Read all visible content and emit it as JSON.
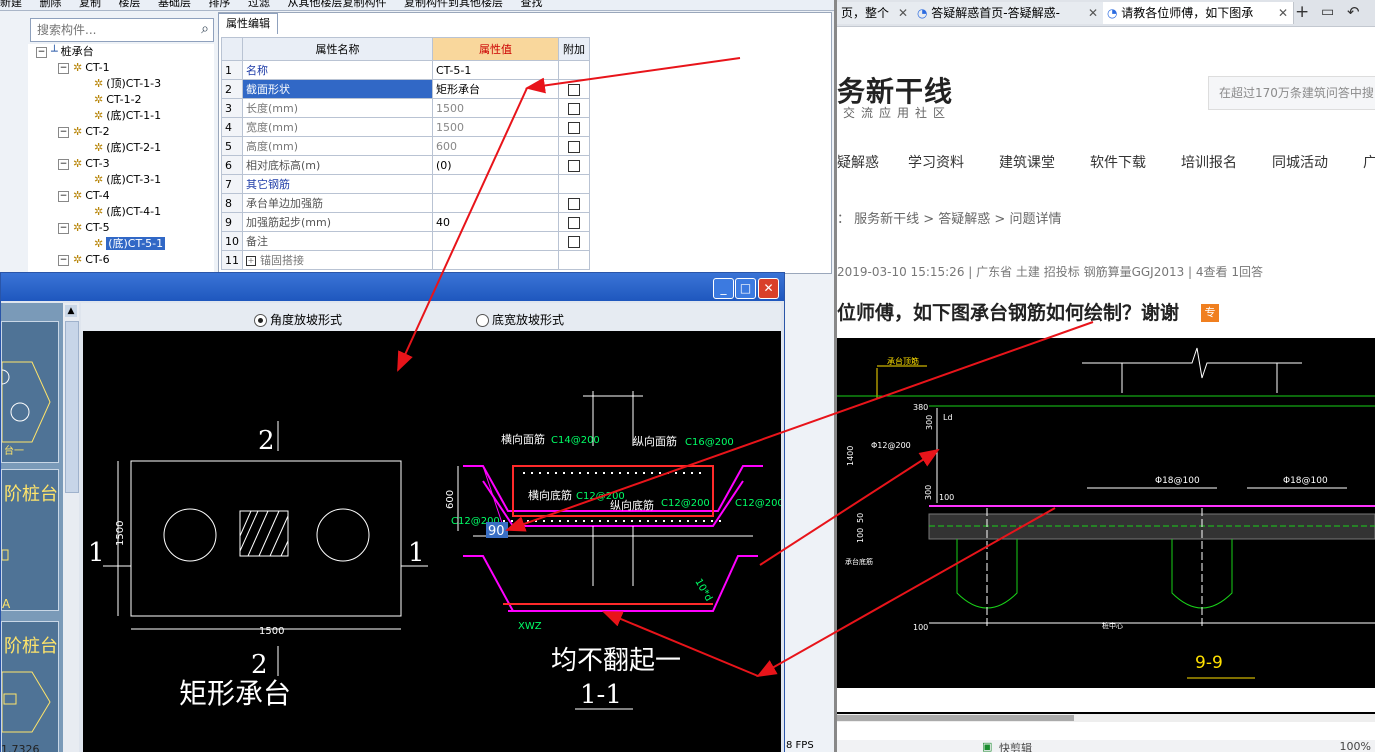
{
  "toolbar": {
    "items": [
      "新建",
      "删除",
      "复制",
      "楼层",
      "基础层",
      "排序",
      "过滤",
      "从其他楼层复制构件",
      "复制构件到其他楼层",
      "查找"
    ]
  },
  "search": {
    "placeholder": "搜索构件..."
  },
  "tree": {
    "root": "桩承台",
    "nodes": [
      {
        "label": "CT-1",
        "level": 1
      },
      {
        "label": "(顶)CT-1-3",
        "level": 2
      },
      {
        "label": "CT-1-2",
        "level": 2
      },
      {
        "label": "(底)CT-1-1",
        "level": 2
      },
      {
        "label": "CT-2",
        "level": 1
      },
      {
        "label": "(底)CT-2-1",
        "level": 2
      },
      {
        "label": "CT-3",
        "level": 1
      },
      {
        "label": "(底)CT-3-1",
        "level": 2
      },
      {
        "label": "CT-4",
        "level": 1
      },
      {
        "label": "(底)CT-4-1",
        "level": 2
      },
      {
        "label": "CT-5",
        "level": 1
      },
      {
        "label": "(底)CT-5-1",
        "level": 2,
        "selected": true
      },
      {
        "label": "CT-6",
        "level": 1
      }
    ]
  },
  "props": {
    "tab": "属性编辑",
    "headers": {
      "name": "属性名称",
      "value": "属性值",
      "extra": "附加"
    },
    "rows": [
      {
        "num": "1",
        "name": "名称",
        "value": "CT-5-1",
        "check": false
      },
      {
        "num": "2",
        "name": "截面形状",
        "value": "矩形承台",
        "check": true
      },
      {
        "num": "3",
        "name": "长度(mm)",
        "value": "1500",
        "check": true
      },
      {
        "num": "4",
        "name": "宽度(mm)",
        "value": "1500",
        "check": true
      },
      {
        "num": "5",
        "name": "高度(mm)",
        "value": "600",
        "check": true
      },
      {
        "num": "6",
        "name": "相对底标高(m)",
        "value": "(0)",
        "check": true
      },
      {
        "num": "7",
        "name": "其它钢筋",
        "value": "",
        "check": false
      },
      {
        "num": "8",
        "name": "承台单边加强筋",
        "value": "",
        "check": true
      },
      {
        "num": "9",
        "name": "加强筋起步(mm)",
        "value": "40",
        "check": true
      },
      {
        "num": "10",
        "name": "备注",
        "value": "",
        "check": true
      },
      {
        "num": "11",
        "name": "锚固搭接",
        "value": "",
        "check": false
      }
    ]
  },
  "dialog": {
    "radio_angle": "角度放坡形式",
    "radio_width": "底宽放坡形式",
    "thumb_labels": [
      "台一",
      "阶桩台",
      "A",
      "阶桩台"
    ],
    "status_left": "1.7326"
  },
  "drawing": {
    "dim_width": "1500",
    "dim_height": "1500",
    "section_top": "2",
    "section_bottom": "2",
    "section_left": "1",
    "section_right": "1",
    "shape_title": "矩形承台",
    "label_top_h": "横向面筋",
    "rebar_top_h": "C14@200",
    "label_top_v": "纵向面筋",
    "rebar_top_v": "C16@200",
    "label_bot_h": "横向底筋",
    "rebar_bot_h": "C12@200",
    "label_bot_v": "纵向底筋",
    "rebar_bot_v": "C12@200",
    "rebar_side_left": "C12@200",
    "rebar_side_right": "C12@200",
    "dim_600": "600",
    "edit_value": "90",
    "slope_label": "10*d",
    "xwz_label": "XWZ",
    "note": "均不翻起一",
    "section_name": "1-1",
    "fps": "8 FPS"
  },
  "browser": {
    "tabs": [
      {
        "label": "页，整个",
        "active": false
      },
      {
        "label": "答疑解惑首页-答疑解惑-",
        "active": false
      },
      {
        "label": "请教各位师傅，如下图承",
        "active": true
      }
    ],
    "logo": "务新干线",
    "logo_sub": "交流应用社区",
    "search_placeholder": "在超过170万条建筑问答中搜",
    "nav": [
      "疑解惑",
      "学习资料",
      "建筑课堂",
      "软件下载",
      "培训报名",
      "同城活动",
      "广"
    ],
    "breadcrumb": "： 服务新干线 > 答疑解惑 > 问题详情",
    "meta": "2019-03-10 15:15:26    |    广东省  土建 招投标 钢筋算量GGJ2013    |    4查看  1回答",
    "title": "位师傅，如下图承台钢筋如何绘制？谢谢",
    "badge": "专",
    "status": "快剪辑",
    "zoom": "100%"
  },
  "cad": {
    "label_top": "承台顶筋",
    "dim_380": "380",
    "ld": "Ld",
    "dim_300": "300",
    "rebar_left": "Φ12@200",
    "dim_1400": "1400",
    "dim_300b": "300",
    "dim_100": "100",
    "rebar_mid": "Φ18@100",
    "rebar_right": "Φ18@100",
    "dim_50": "50",
    "dim_100b": "100",
    "bottom_label": "承台底筋",
    "dim_100c": "100",
    "pile_label": "桩中心",
    "section": "9-9"
  }
}
